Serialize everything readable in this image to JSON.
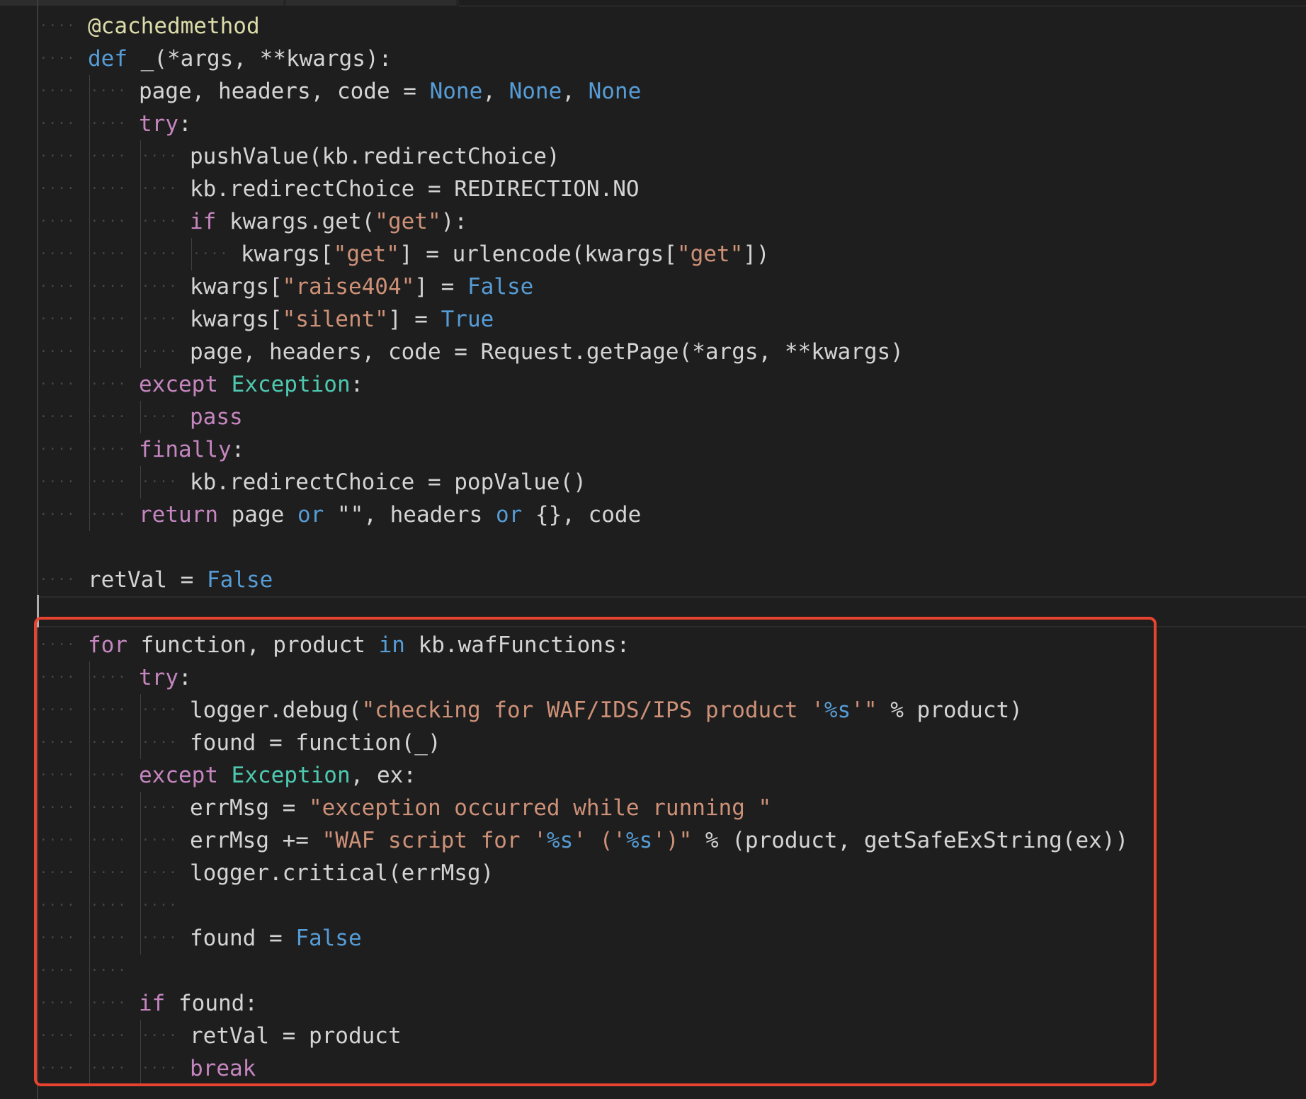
{
  "editor": {
    "theme": "dark",
    "colors": {
      "background": "#1e1e1e",
      "decorator": "#dcdcaa",
      "keyword": "#c586c0",
      "storage": "#569cd6",
      "constant": "#569cd6",
      "string": "#ce9178",
      "class": "#4ec9b0",
      "text": "#d4d4d4",
      "highlight_box": "#e8432e"
    },
    "lines": [
      {
        "indent": 1,
        "tokens": [
          {
            "t": "@cachedmethod",
            "c": "dec"
          }
        ]
      },
      {
        "indent": 1,
        "tokens": [
          {
            "t": "def",
            "c": "def"
          },
          {
            "t": " _(",
            "c": "plain"
          },
          {
            "t": "*args",
            "c": "plain"
          },
          {
            "t": ", ",
            "c": "plain"
          },
          {
            "t": "**kwargs",
            "c": "plain"
          },
          {
            "t": "):",
            "c": "plain"
          }
        ]
      },
      {
        "indent": 2,
        "tokens": [
          {
            "t": "page, headers, code = ",
            "c": "plain"
          },
          {
            "t": "None",
            "c": "const"
          },
          {
            "t": ", ",
            "c": "plain"
          },
          {
            "t": "None",
            "c": "const"
          },
          {
            "t": ", ",
            "c": "plain"
          },
          {
            "t": "None",
            "c": "const"
          }
        ]
      },
      {
        "indent": 2,
        "tokens": [
          {
            "t": "try",
            "c": "kw"
          },
          {
            "t": ":",
            "c": "plain"
          }
        ]
      },
      {
        "indent": 3,
        "tokens": [
          {
            "t": "pushValue(kb.redirectChoice)",
            "c": "plain"
          }
        ]
      },
      {
        "indent": 3,
        "tokens": [
          {
            "t": "kb.redirectChoice = REDIRECTION.NO",
            "c": "plain"
          }
        ]
      },
      {
        "indent": 3,
        "tokens": [
          {
            "t": "if",
            "c": "kw"
          },
          {
            "t": " kwargs.get(",
            "c": "plain"
          },
          {
            "t": "\"get\"",
            "c": "str"
          },
          {
            "t": "):",
            "c": "plain"
          }
        ]
      },
      {
        "indent": 4,
        "tokens": [
          {
            "t": "kwargs[",
            "c": "plain"
          },
          {
            "t": "\"get\"",
            "c": "str"
          },
          {
            "t": "] = urlencode(kwargs[",
            "c": "plain"
          },
          {
            "t": "\"get\"",
            "c": "str"
          },
          {
            "t": "])",
            "c": "plain"
          }
        ]
      },
      {
        "indent": 3,
        "tokens": [
          {
            "t": "kwargs[",
            "c": "plain"
          },
          {
            "t": "\"raise404\"",
            "c": "str"
          },
          {
            "t": "] = ",
            "c": "plain"
          },
          {
            "t": "False",
            "c": "const"
          }
        ]
      },
      {
        "indent": 3,
        "tokens": [
          {
            "t": "kwargs[",
            "c": "plain"
          },
          {
            "t": "\"silent\"",
            "c": "str"
          },
          {
            "t": "] = ",
            "c": "plain"
          },
          {
            "t": "True",
            "c": "const"
          }
        ]
      },
      {
        "indent": 3,
        "tokens": [
          {
            "t": "page, headers, code = Request.getPage(*args, **kwargs)",
            "c": "plain"
          }
        ]
      },
      {
        "indent": 2,
        "tokens": [
          {
            "t": "except",
            "c": "kw"
          },
          {
            "t": " ",
            "c": "plain"
          },
          {
            "t": "Exception",
            "c": "cls"
          },
          {
            "t": ":",
            "c": "plain"
          }
        ]
      },
      {
        "indent": 3,
        "tokens": [
          {
            "t": "pass",
            "c": "kw"
          }
        ]
      },
      {
        "indent": 2,
        "tokens": [
          {
            "t": "finally",
            "c": "kw"
          },
          {
            "t": ":",
            "c": "plain"
          }
        ]
      },
      {
        "indent": 3,
        "tokens": [
          {
            "t": "kb.redirectChoice = popValue()",
            "c": "plain"
          }
        ]
      },
      {
        "indent": 2,
        "tokens": [
          {
            "t": "return",
            "c": "kw"
          },
          {
            "t": " page ",
            "c": "plain"
          },
          {
            "t": "or",
            "c": "def"
          },
          {
            "t": " \"\", headers ",
            "c": "plain"
          },
          {
            "t": "or",
            "c": "def"
          },
          {
            "t": " {}, code",
            "c": "plain"
          }
        ]
      },
      {
        "indent": 0,
        "tokens": []
      },
      {
        "indent": 1,
        "tokens": [
          {
            "t": "retVal = ",
            "c": "plain"
          },
          {
            "t": "False",
            "c": "const"
          }
        ]
      },
      {
        "indent": 0,
        "tokens": []
      },
      {
        "indent": 1,
        "tokens": [
          {
            "t": "for",
            "c": "kw"
          },
          {
            "t": " function, product ",
            "c": "plain"
          },
          {
            "t": "in",
            "c": "def"
          },
          {
            "t": " kb.wafFunctions:",
            "c": "plain"
          }
        ]
      },
      {
        "indent": 2,
        "tokens": [
          {
            "t": "try",
            "c": "kw"
          },
          {
            "t": ":",
            "c": "plain"
          }
        ]
      },
      {
        "indent": 3,
        "tokens": [
          {
            "t": "logger.debug(",
            "c": "plain"
          },
          {
            "t": "\"checking for WAF/IDS/IPS product '",
            "c": "str"
          },
          {
            "t": "%s",
            "c": "fmt"
          },
          {
            "t": "'\"",
            "c": "str"
          },
          {
            "t": " % product)",
            "c": "plain"
          }
        ]
      },
      {
        "indent": 3,
        "tokens": [
          {
            "t": "found = function(_)",
            "c": "plain"
          }
        ]
      },
      {
        "indent": 2,
        "tokens": [
          {
            "t": "except",
            "c": "kw"
          },
          {
            "t": " ",
            "c": "plain"
          },
          {
            "t": "Exception",
            "c": "cls"
          },
          {
            "t": ", ex:",
            "c": "plain"
          }
        ]
      },
      {
        "indent": 3,
        "tokens": [
          {
            "t": "errMsg = ",
            "c": "plain"
          },
          {
            "t": "\"exception occurred while running \"",
            "c": "str"
          }
        ]
      },
      {
        "indent": 3,
        "tokens": [
          {
            "t": "errMsg += ",
            "c": "plain"
          },
          {
            "t": "\"WAF script for '",
            "c": "str"
          },
          {
            "t": "%s",
            "c": "fmt"
          },
          {
            "t": "' ('",
            "c": "str"
          },
          {
            "t": "%s",
            "c": "fmt"
          },
          {
            "t": "')\"",
            "c": "str"
          },
          {
            "t": " % (product, getSafeExString(ex))",
            "c": "plain"
          }
        ]
      },
      {
        "indent": 3,
        "tokens": [
          {
            "t": "logger.critical(errMsg)",
            "c": "plain"
          }
        ]
      },
      {
        "indent": 0,
        "guides": 3,
        "tokens": []
      },
      {
        "indent": 3,
        "tokens": [
          {
            "t": "found = ",
            "c": "plain"
          },
          {
            "t": "False",
            "c": "const"
          }
        ]
      },
      {
        "indent": 0,
        "guides": 2,
        "tokens": []
      },
      {
        "indent": 2,
        "tokens": [
          {
            "t": "if",
            "c": "kw"
          },
          {
            "t": " found:",
            "c": "plain"
          }
        ]
      },
      {
        "indent": 3,
        "tokens": [
          {
            "t": "retVal = product",
            "c": "plain"
          }
        ]
      },
      {
        "indent": 3,
        "tokens": [
          {
            "t": "break",
            "c": "kw"
          }
        ]
      }
    ]
  }
}
